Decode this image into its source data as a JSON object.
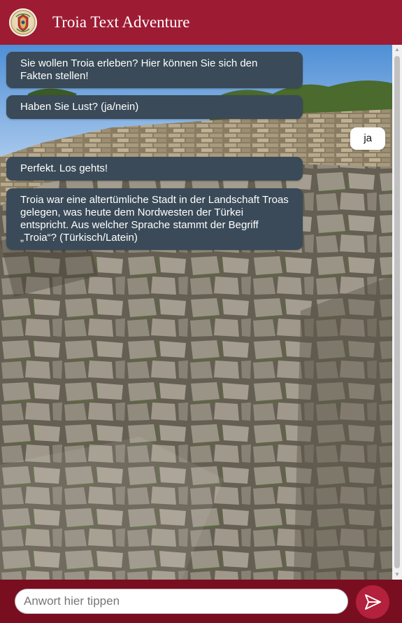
{
  "header": {
    "title": "Troia Text Adventure",
    "logo_icon": "crest-icon"
  },
  "colors": {
    "header_bg": "#9e1b34",
    "footer_bg": "#7a0e21",
    "bot_bubble": "#3a4a58",
    "user_bubble": "#ffffff",
    "send_button": "#b3213d"
  },
  "messages": [
    {
      "from": "bot",
      "text": "Sie wollen Troia erleben? Hier können Sie sich den Fakten stellen!"
    },
    {
      "from": "bot",
      "text": "Haben Sie Lust? (ja/nein)"
    },
    {
      "from": "user",
      "text": "ja"
    },
    {
      "from": "bot",
      "text": "Perfekt. Los gehts!"
    },
    {
      "from": "bot",
      "text": "Troia war eine altertümliche Stadt in der Landschaft Troas gelegen, was heute dem Nordwesten der Türkei entspricht. Aus welcher Sprache stammt der Begriff „Troia“? (Türkisch/Latein)"
    }
  ],
  "composer": {
    "placeholder": "Anwort hier tippen",
    "value": "",
    "send_icon": "send-icon"
  }
}
